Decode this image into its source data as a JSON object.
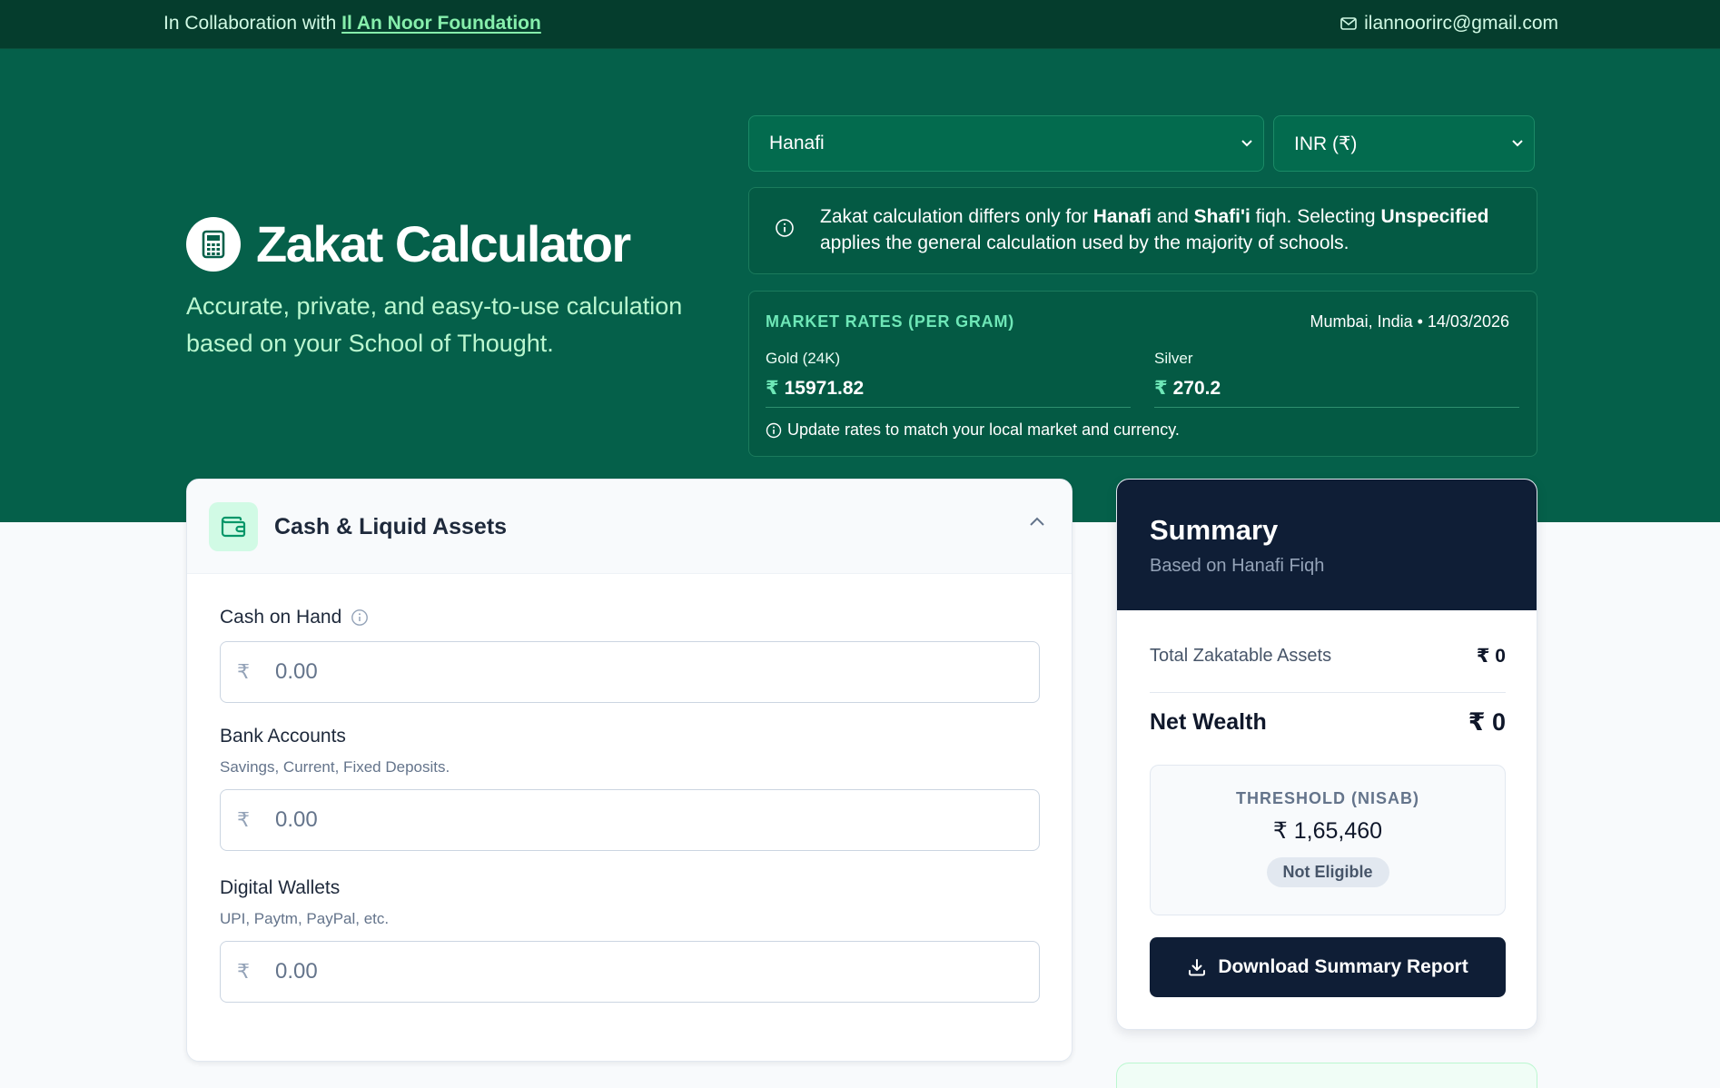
{
  "topbar": {
    "collab_prefix": "In Collaboration with",
    "collab_link": "Il An Noor Foundation",
    "email": "ilannoorirc@gmail.com"
  },
  "hero": {
    "title": "Zakat Calculator",
    "subtitle": "Accurate, private, and easy-to-use calculation based on your School of Thought.",
    "school_select": "Hanafi",
    "currency_select": "INR (₹)",
    "info": {
      "part1": "Zakat calculation differs only for ",
      "b1": "Hanafi",
      "part2": " and ",
      "b2": "Shafi'i",
      "part3": " fiqh. Selecting ",
      "b3": "Unspecified",
      "part4": " applies the general calculation used by the majority of schools."
    },
    "rates": {
      "title": "MARKET RATES (PER GRAM)",
      "location": "Mumbai, India • 14/03/2026",
      "gold_label": "Gold (24K)",
      "gold_value": "15971.82",
      "silver_label": "Silver",
      "silver_value": "270.2",
      "currency_symbol": "₹",
      "note": "Update rates to match your local market and currency."
    }
  },
  "card": {
    "title": "Cash & Liquid Assets",
    "fields": [
      {
        "label": "Cash on Hand",
        "hint": "",
        "placeholder": "0.00"
      },
      {
        "label": "Bank Accounts",
        "hint": "Savings, Current, Fixed Deposits.",
        "placeholder": "0.00"
      },
      {
        "label": "Digital Wallets",
        "hint": "UPI, Paytm, PayPal, etc.",
        "placeholder": "0.00"
      }
    ],
    "currency_symbol": "₹"
  },
  "summary": {
    "title": "Summary",
    "subtitle": "Based on Hanafi Fiqh",
    "total_label": "Total Zakatable Assets",
    "total_value": "₹ 0",
    "net_label": "Net Wealth",
    "net_value": "₹ 0",
    "nisab_label": "THRESHOLD (NISAB)",
    "nisab_value": "₹ 1,65,460",
    "status": "Not Eligible",
    "download_label": "Download Summary Report"
  },
  "colors": {
    "brand_green": "#05604a",
    "dark_green": "#053d2d",
    "navy": "#0f1e36",
    "accent_mint": "#6ee7b7"
  }
}
